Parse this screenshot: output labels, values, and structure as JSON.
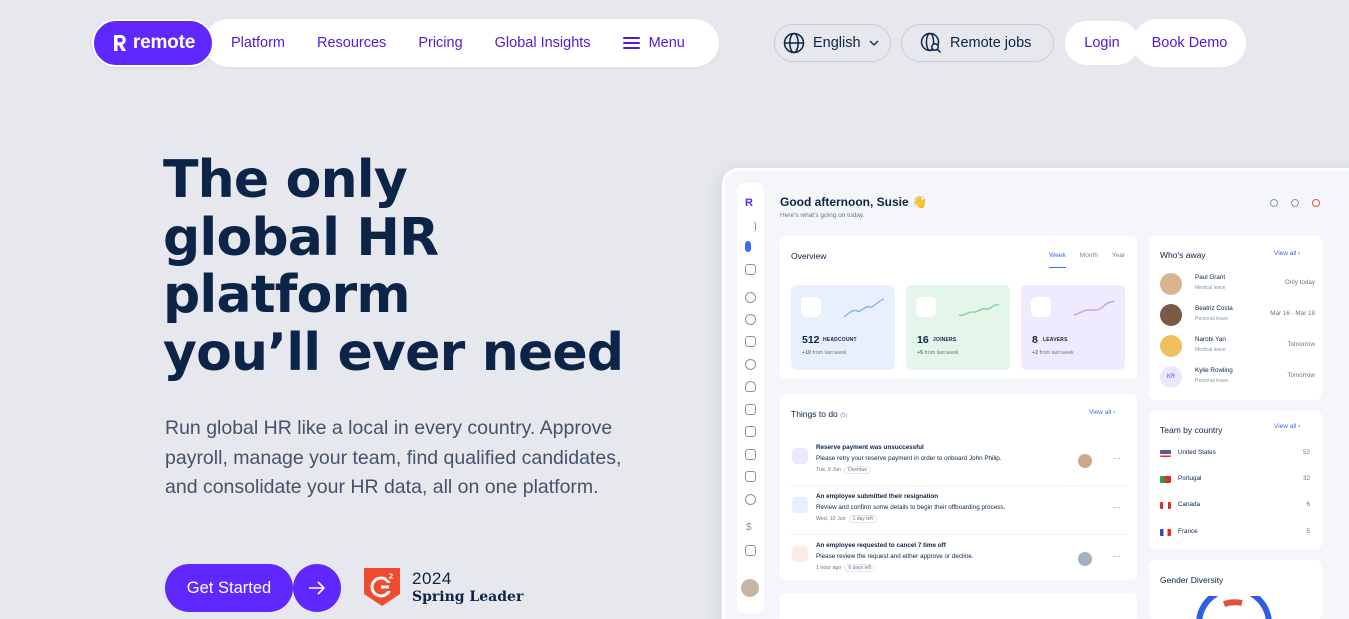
{
  "brand": {
    "name": "remote",
    "color": "#5f28ff"
  },
  "nav": {
    "links": [
      "Platform",
      "Resources",
      "Pricing",
      "Global Insights"
    ],
    "menu_label": "Menu",
    "language": "English",
    "remote_jobs": "Remote jobs",
    "login": "Login",
    "book_demo": "Book Demo"
  },
  "hero": {
    "title_lines": [
      "The only",
      "global HR",
      "platform",
      "you’ll ever need"
    ],
    "subtitle": "Run global HR like a local in every country. Approve payroll, manage your team, find qualified candidates, and consolidate your HR data, all on one platform.",
    "cta": "Get Started",
    "badge": {
      "year": "2024",
      "label": "Spring Leader"
    }
  },
  "dashboard": {
    "greeting": "Good afternoon, Susie 👋",
    "greeting_sub": "Here's what's going on today.",
    "overview": {
      "title": "Overview",
      "tabs": [
        "Week",
        "Month",
        "Year"
      ],
      "active_tab": "Week",
      "stats": [
        {
          "value": "512",
          "label": "HEADCOUNT",
          "delta": "+10",
          "delta_text": "from last week",
          "color": "#e9f0fd"
        },
        {
          "value": "16",
          "label": "JOINERS",
          "delta": "+5",
          "delta_text": "from last week",
          "color": "#e4f6ea"
        },
        {
          "value": "8",
          "label": "LEAVERS",
          "delta": "+2",
          "delta_text": "from last week",
          "color": "#efeafd"
        }
      ]
    },
    "todo": {
      "title": "Things to do",
      "count": "(5)",
      "view_all": "View all",
      "items": [
        {
          "title": "Reserve payment was unsuccessful",
          "desc": "Please retry your reserve payment in order to onboard John Philip.",
          "date": "Tue, 9 Jun",
          "badge": "Overdue",
          "icon_color": "#eeeafd"
        },
        {
          "title": "An employee submitted their resignation",
          "desc": "Review and confirm some details to begin their offboarding process.",
          "date": "Wed, 10 Jun",
          "badge": "1 day left",
          "icon_color": "#e6efff"
        },
        {
          "title": "An employee requested to cancel 7 time off",
          "desc": "Please review the request and either approve or decline.",
          "date": "1 hour ago",
          "badge": "6 days left",
          "icon_color": "#fdece4"
        }
      ]
    },
    "away": {
      "title": "Who's away",
      "view_all": "View all",
      "people": [
        {
          "name": "Paul Grant",
          "status": "Medical leave",
          "date": "Only today",
          "initials": "",
          "color": "#d9b48e"
        },
        {
          "name": "Beatriz Costa",
          "status": "Personal leave",
          "date": "Mar 16 - Mar 18",
          "initials": "",
          "color": "#7a5a45"
        },
        {
          "name": "Narobi Yan",
          "status": "Medical leave",
          "date": "Tomorrow",
          "initials": "",
          "color": "#f0c060"
        },
        {
          "name": "Kylie Rowling",
          "status": "Personal leave",
          "date": "Tomorrow",
          "initials": "KR",
          "color": "#ece8fb"
        }
      ]
    },
    "countries": {
      "title": "Team by country",
      "view_all": "View all",
      "rows": [
        {
          "name": "United States",
          "count": "52",
          "flag": "#3b5fc4"
        },
        {
          "name": "Portugal",
          "count": "32",
          "flag": "#2e9e4a"
        },
        {
          "name": "Canada",
          "count": "6",
          "flag": "#d9302c"
        },
        {
          "name": "France",
          "count": "5",
          "flag": "#2a4bb0"
        }
      ]
    },
    "gender": {
      "title": "Gender Diversity"
    }
  }
}
